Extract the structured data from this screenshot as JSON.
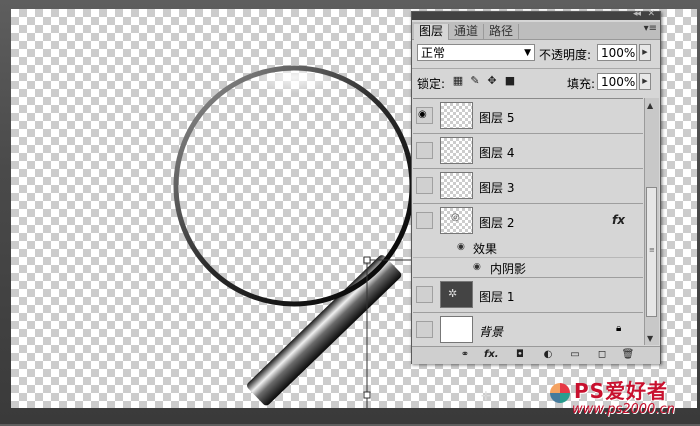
{
  "panel": {
    "tabs": [
      "图层",
      "通道",
      "路径"
    ],
    "blend_mode": "正常",
    "opacity_label": "不透明度:",
    "opacity_value": "100%",
    "lock_label": "锁定:",
    "fill_label": "填充:",
    "fill_value": "100%",
    "layers": [
      {
        "name": "图层 5",
        "visible": true
      },
      {
        "name": "图层 4",
        "visible": false
      },
      {
        "name": "图层 3",
        "visible": false
      },
      {
        "name": "图层 2",
        "visible": false,
        "fx": "fx"
      },
      {
        "name": "图层 1",
        "visible": false
      },
      {
        "name": "背景",
        "visible": false
      }
    ],
    "effects_label": "效果",
    "inner_shadow_label": "内阴影",
    "bottom_icons": [
      "link-icon",
      "fx-icon",
      "mask-icon",
      "adjustment-icon",
      "folder-icon",
      "new-layer-icon",
      "trash-icon"
    ],
    "bottom_fx": "fx."
  },
  "watermark": {
    "brand": "PS爱好者",
    "url": "www.ps2000.cn"
  },
  "colors": {
    "panel_bg": "#d6d6d6",
    "workspace": "#4a4a4a",
    "brand_red": "#c8102e"
  }
}
